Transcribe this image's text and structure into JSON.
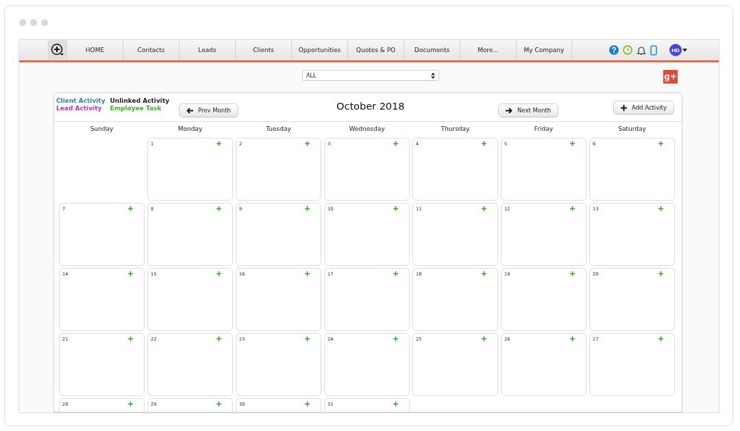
{
  "nav": {
    "items": [
      {
        "label": "HOME"
      },
      {
        "label": "Contacts"
      },
      {
        "label": "Leads"
      },
      {
        "label": "Clients"
      },
      {
        "label": "Opportunities"
      },
      {
        "label": "Quotes & PO"
      },
      {
        "label": "Documents"
      },
      {
        "label": "More..."
      },
      {
        "label": "My Company"
      }
    ],
    "avatar": "HD"
  },
  "filter": {
    "value": "ALL"
  },
  "gplus": "g+",
  "legend": [
    {
      "label": "Client Activity",
      "color": "#2f7fc1"
    },
    {
      "label": "Unlinked Activity",
      "color": "#222222"
    },
    {
      "label": "Lead Activity",
      "color": "#c02fc0"
    },
    {
      "label": "Employee Task",
      "color": "#3cb62a"
    }
  ],
  "calendar": {
    "title": "October 2018",
    "prev": "Prev Month",
    "next": "Next Month",
    "add": "Add Activity",
    "weekdays": [
      "Sunday",
      "Monday",
      "Tuesday",
      "Wednesday",
      "Thursday",
      "Friday",
      "Saturday"
    ],
    "weeks": [
      [
        {
          "kind": "blank"
        },
        {
          "kind": "day",
          "day": "1"
        },
        {
          "kind": "day",
          "day": "2"
        },
        {
          "kind": "day",
          "day": "3"
        },
        {
          "kind": "day",
          "day": "4"
        },
        {
          "kind": "day",
          "day": "5"
        },
        {
          "kind": "day",
          "day": "6"
        }
      ],
      [
        {
          "kind": "day",
          "day": "7"
        },
        {
          "kind": "day",
          "day": "8"
        },
        {
          "kind": "day",
          "day": "9"
        },
        {
          "kind": "day",
          "day": "10"
        },
        {
          "kind": "day",
          "day": "11"
        },
        {
          "kind": "day",
          "day": "12"
        },
        {
          "kind": "day",
          "day": "13"
        }
      ],
      [
        {
          "kind": "day",
          "day": "14"
        },
        {
          "kind": "day",
          "day": "15"
        },
        {
          "kind": "day",
          "day": "16"
        },
        {
          "kind": "day",
          "day": "17"
        },
        {
          "kind": "day",
          "day": "18"
        },
        {
          "kind": "day",
          "day": "19"
        },
        {
          "kind": "day",
          "day": "20"
        }
      ],
      [
        {
          "kind": "day",
          "day": "21"
        },
        {
          "kind": "day",
          "day": "22"
        },
        {
          "kind": "day",
          "day": "23"
        },
        {
          "kind": "day",
          "day": "24"
        },
        {
          "kind": "day",
          "day": "25"
        },
        {
          "kind": "day",
          "day": "26"
        },
        {
          "kind": "day",
          "day": "27"
        }
      ],
      [
        {
          "kind": "day",
          "day": "28"
        },
        {
          "kind": "day",
          "day": "29"
        },
        {
          "kind": "day",
          "day": "30"
        },
        {
          "kind": "day",
          "day": "31"
        },
        {
          "kind": "blank"
        },
        {
          "kind": "blank"
        },
        {
          "kind": "blank"
        }
      ]
    ]
  }
}
